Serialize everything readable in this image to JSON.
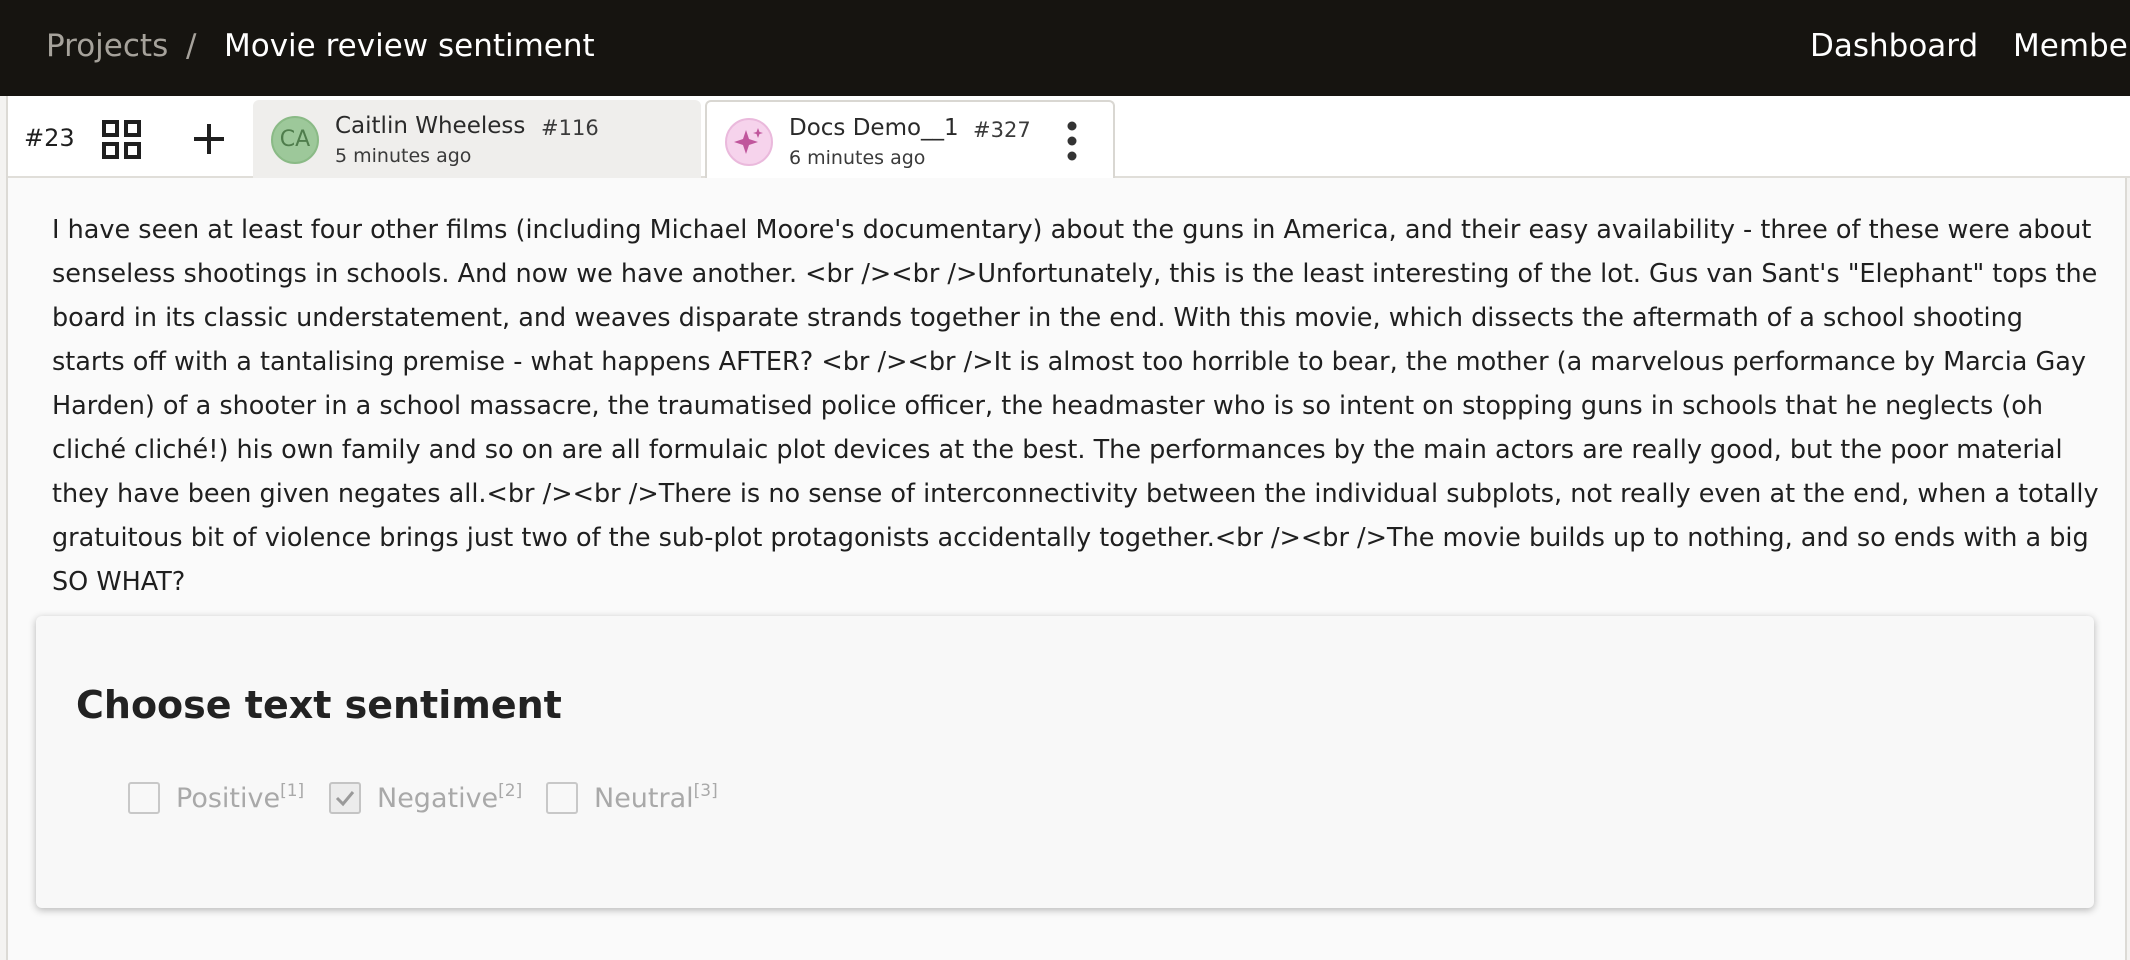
{
  "header": {
    "breadcrumb_root": "Projects",
    "breadcrumb_separator": "/",
    "project_name": "Movie review sentiment",
    "nav": {
      "dashboard": "Dashboard",
      "members": "Members"
    }
  },
  "toolbar": {
    "task_id": "#23",
    "grid_icon": "grid-icon",
    "add_icon": "plus-icon"
  },
  "tabs": [
    {
      "avatar_initials": "CA",
      "name": "Caitlin Wheeless",
      "number": "#116",
      "time": "5 minutes ago",
      "active": false
    },
    {
      "avatar_icon": "sparkles-icon",
      "name": "Docs Demo__1",
      "number": "#327",
      "time": "6 minutes ago",
      "active": true,
      "menu_icon": "kebab-icon"
    }
  ],
  "review_text": "I have seen at least four other films (including Michael Moore's documentary) about the guns in America, and their easy availability - three of these were about senseless shootings in schools. And now we have another. <br /><br />Unfortunately, this is the least interesting of the lot. Gus van Sant's \"Elephant\" tops the board in its classic understatement, and weaves disparate strands together in the end. With this movie, which dissects the aftermath of a school shooting starts off with a tantalising premise - what happens AFTER? <br /><br />It is almost too horrible to bear, the mother (a marvelous performance by Marcia Gay Harden) of a shooter in a school massacre, the traumatised police officer, the headmaster who is so intent on stopping guns in schools that he neglects (oh cliché cliché!) his own family and so on are all formulaic plot devices at the best. The performances by the main actors are really good, but the poor material they have been given negates all.<br /><br />There is no sense of interconnectivity between the individual subplots, not really even at the end, when a totally gratuitous bit of violence brings just two of the sub-plot protagonists accidentally together.<br /><br />The movie builds up to nothing, and so ends with a big SO WHAT?",
  "sentiment": {
    "title": "Choose text sentiment",
    "choices": [
      {
        "label": "Positive",
        "hotkey": "[1]",
        "checked": false
      },
      {
        "label": "Negative",
        "hotkey": "[2]",
        "checked": true
      },
      {
        "label": "Neutral",
        "hotkey": "[3]",
        "checked": false
      }
    ]
  },
  "colors": {
    "topbar_bg": "#161410",
    "avatar_green": "#9dc89a",
    "avatar_pink": "#f6d3ec",
    "choice_text": "#a9a9a9"
  }
}
